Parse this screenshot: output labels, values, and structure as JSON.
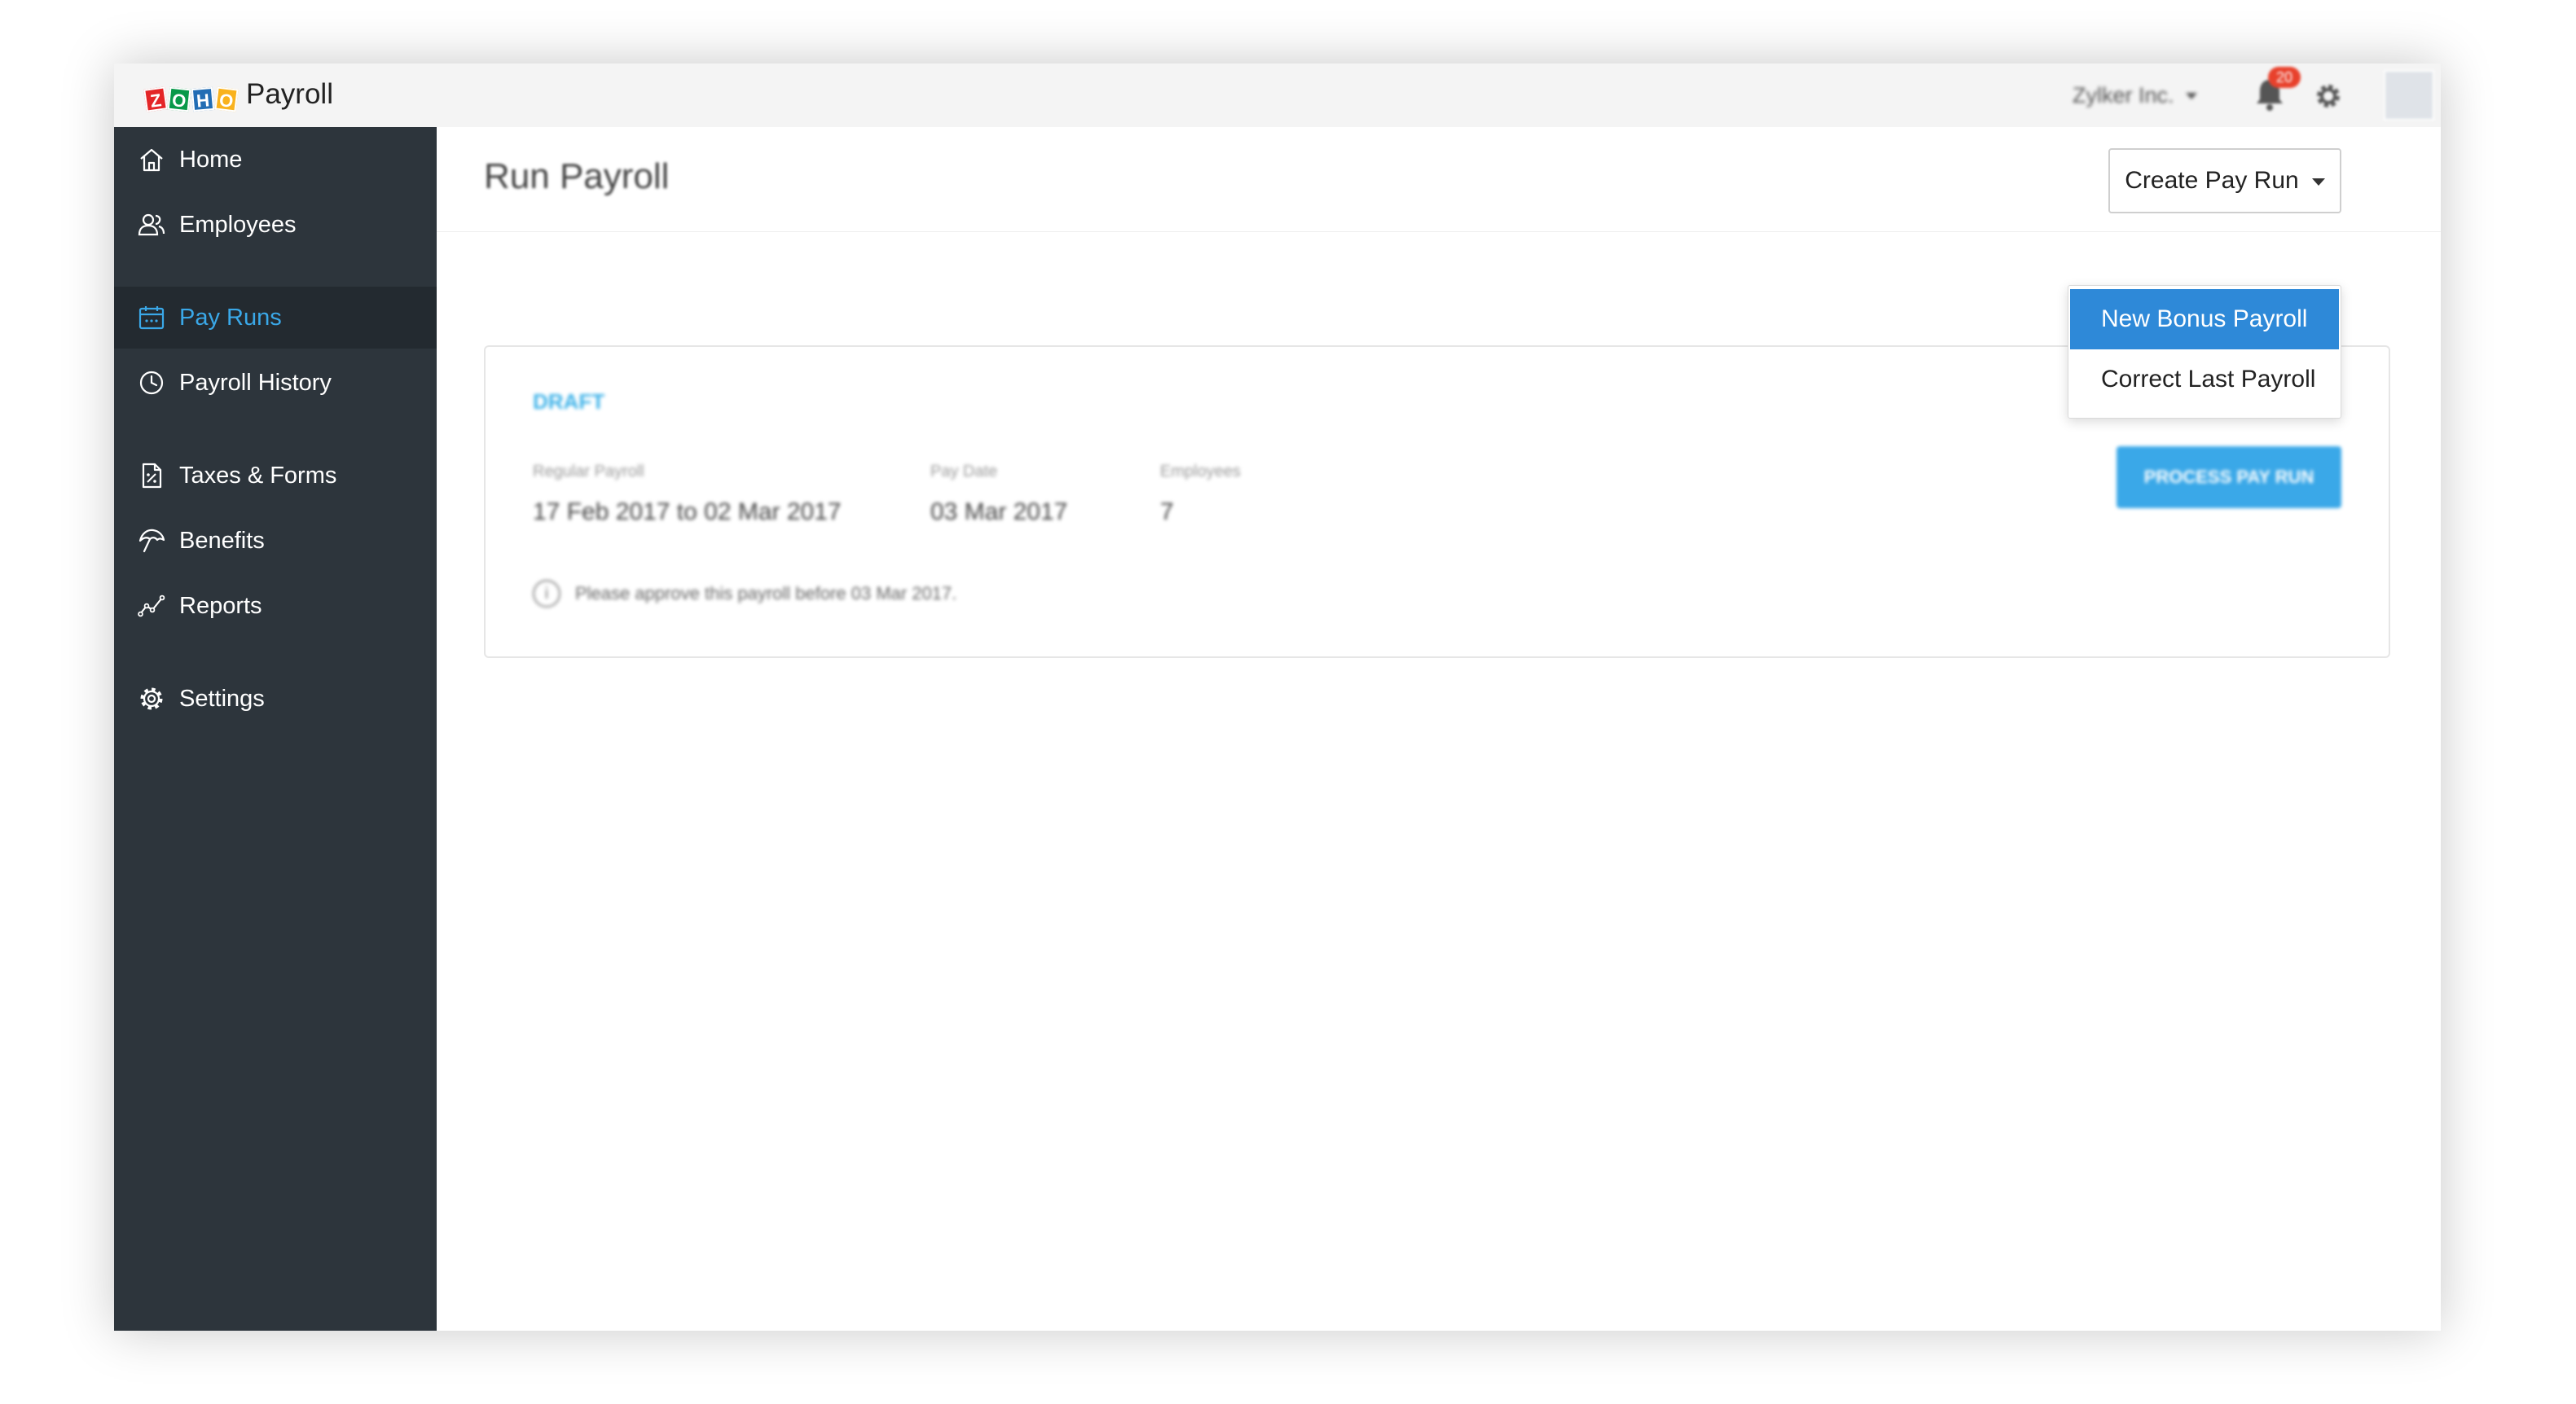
{
  "app": {
    "product_name": "Payroll",
    "logo_letters": [
      "Z",
      "O",
      "H",
      "O"
    ],
    "org_name": "Zylker Inc.",
    "notification_count": "20"
  },
  "sidebar": {
    "items": [
      {
        "label": "Home",
        "icon": "home-icon"
      },
      {
        "label": "Employees",
        "icon": "users-icon"
      },
      {
        "label": "Pay Runs",
        "icon": "calendar-icon",
        "active": true
      },
      {
        "label": "Payroll History",
        "icon": "clock-icon"
      },
      {
        "label": "Taxes & Forms",
        "icon": "document-icon"
      },
      {
        "label": "Benefits",
        "icon": "umbrella-icon"
      },
      {
        "label": "Reports",
        "icon": "chart-line-icon"
      },
      {
        "label": "Settings",
        "icon": "gear-icon"
      }
    ]
  },
  "page": {
    "title": "Run Payroll",
    "create_button_label": "Create Pay Run",
    "dropdown_items": [
      "New Bonus Payroll",
      "Correct Last Payroll"
    ]
  },
  "draft": {
    "status": "DRAFT",
    "period_label": "Regular Payroll",
    "period_value": "17 Feb 2017 to 02 Mar 2017",
    "pay_date_label": "Pay Date",
    "pay_date_value": "03 Mar 2017",
    "employees_label": "Employees",
    "employees_value": "7",
    "process_button_label": "PROCESS PAY RUN",
    "note": "Please approve this payroll before 03 Mar 2017."
  },
  "colors": {
    "sidebar_bg": "#2d353c",
    "accent": "#3aa8e8",
    "dropdown_highlight": "#2e89d8",
    "badge": "#e8412c"
  }
}
